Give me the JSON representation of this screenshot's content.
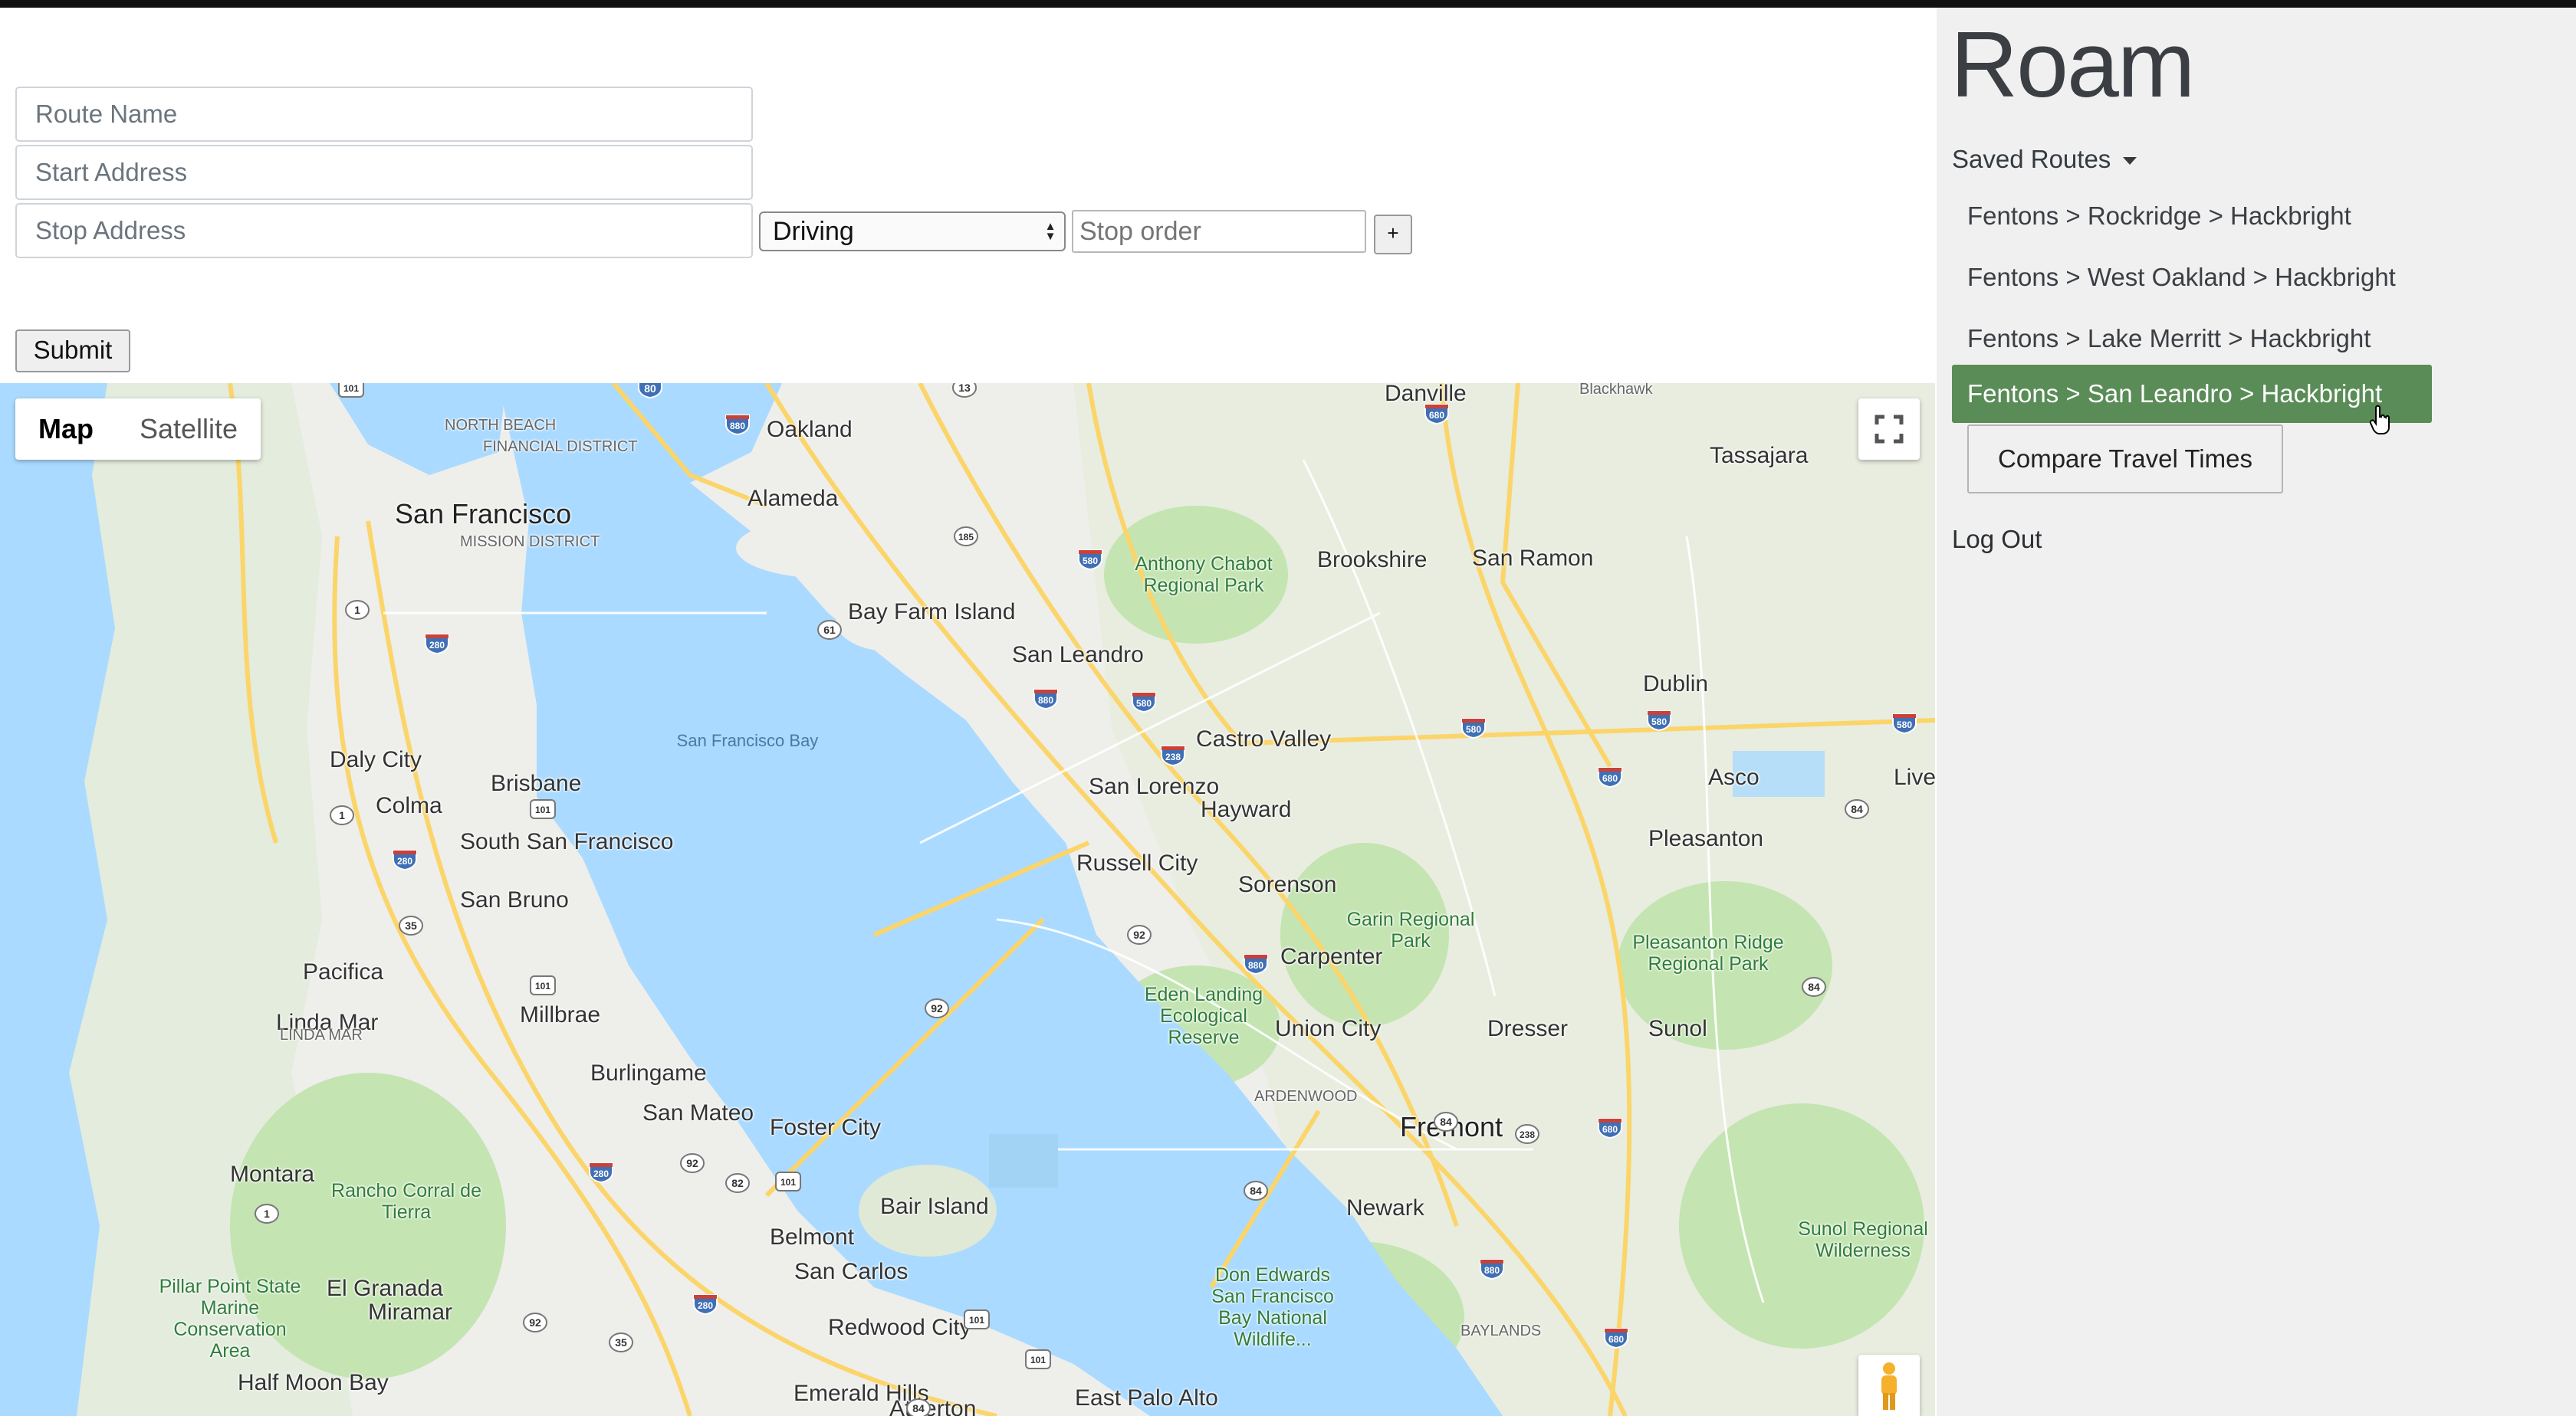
{
  "app": {
    "brand": "Roam"
  },
  "form": {
    "route_name_placeholder": "Route Name",
    "start_address_placeholder": "Start Address",
    "stop_address_placeholder": "Stop Address",
    "mode_selected": "Driving",
    "stop_order_placeholder": "Stop order",
    "add_stop_label": "+",
    "submit_label": "Submit"
  },
  "sidebar": {
    "saved_routes_label": "Saved Routes",
    "routes": [
      {
        "label": "Fentons > Rockridge > Hackbright",
        "active": false
      },
      {
        "label": "Fentons > West Oakland > Hackbright",
        "active": false
      },
      {
        "label": "Fentons > Lake Merritt > Hackbright",
        "active": false
      },
      {
        "label": "Fentons > San Leandro > Hackbright",
        "active": true
      }
    ],
    "compare_label": "Compare Travel Times",
    "logout_label": "Log Out"
  },
  "map": {
    "type_map_label": "Map",
    "type_satellite_label": "Satellite",
    "colors": {
      "water": "#aadaff",
      "land": "#eeeeeb",
      "park": "#c4e4b2",
      "highway": "#fbd56a"
    },
    "places": [
      {
        "name": "Danville",
        "kind": "city"
      },
      {
        "name": "Blackhawk",
        "kind": "small"
      },
      {
        "name": "Oakland",
        "kind": "city"
      },
      {
        "name": "NORTH BEACH",
        "kind": "small"
      },
      {
        "name": "FINANCIAL DISTRICT",
        "kind": "small"
      },
      {
        "name": "Tassajara",
        "kind": "city"
      },
      {
        "name": "Alameda",
        "kind": "city"
      },
      {
        "name": "San Francisco",
        "kind": "big"
      },
      {
        "name": "MISSION DISTRICT",
        "kind": "small"
      },
      {
        "name": "Anthony Chabot Regional Park",
        "kind": "park"
      },
      {
        "name": "Brookshire",
        "kind": "city"
      },
      {
        "name": "San Ramon",
        "kind": "city"
      },
      {
        "name": "Bay Farm Island",
        "kind": "city"
      },
      {
        "name": "San Leandro",
        "kind": "city"
      },
      {
        "name": "Dublin",
        "kind": "city"
      },
      {
        "name": "Castro Valley",
        "kind": "city"
      },
      {
        "name": "San Francisco Bay",
        "kind": "water"
      },
      {
        "name": "Daly City",
        "kind": "city"
      },
      {
        "name": "Brisbane",
        "kind": "city"
      },
      {
        "name": "Asco",
        "kind": "city"
      },
      {
        "name": "Liver",
        "kind": "city"
      },
      {
        "name": "San Lorenzo",
        "kind": "city"
      },
      {
        "name": "Colma",
        "kind": "city"
      },
      {
        "name": "Hayward",
        "kind": "city"
      },
      {
        "name": "Pleasanton",
        "kind": "city"
      },
      {
        "name": "South San Francisco",
        "kind": "city"
      },
      {
        "name": "Russell City",
        "kind": "city"
      },
      {
        "name": "Sorenson",
        "kind": "city"
      },
      {
        "name": "San Bruno",
        "kind": "city"
      },
      {
        "name": "Garin Regional Park",
        "kind": "park"
      },
      {
        "name": "Pleasanton Ridge Regional Park",
        "kind": "park"
      },
      {
        "name": "Carpenter",
        "kind": "city"
      },
      {
        "name": "Pacifica",
        "kind": "city"
      },
      {
        "name": "Eden Landing Ecological Reserve",
        "kind": "park"
      },
      {
        "name": "Millbrae",
        "kind": "city"
      },
      {
        "name": "Linda Mar",
        "kind": "city"
      },
      {
        "name": "LINDA MAR",
        "kind": "small"
      },
      {
        "name": "Union City",
        "kind": "city"
      },
      {
        "name": "Dresser",
        "kind": "city"
      },
      {
        "name": "Sunol",
        "kind": "city"
      },
      {
        "name": "Burlingame",
        "kind": "city"
      },
      {
        "name": "ARDENWOOD",
        "kind": "small"
      },
      {
        "name": "San Mateo",
        "kind": "city"
      },
      {
        "name": "Foster City",
        "kind": "city"
      },
      {
        "name": "Fremont",
        "kind": "big"
      },
      {
        "name": "Montara",
        "kind": "city"
      },
      {
        "name": "Rancho Corral de Tierra",
        "kind": "park"
      },
      {
        "name": "Bair Island",
        "kind": "city"
      },
      {
        "name": "Newark",
        "kind": "city"
      },
      {
        "name": "Belmont",
        "kind": "city"
      },
      {
        "name": "Sunol Regional Wilderness",
        "kind": "park"
      },
      {
        "name": "San Carlos",
        "kind": "city"
      },
      {
        "name": "Pillar Point State Marine Conservation Area",
        "kind": "park"
      },
      {
        "name": "El Granada",
        "kind": "city"
      },
      {
        "name": "Miramar",
        "kind": "city"
      },
      {
        "name": "Don Edwards San Francisco Bay National Wildlife...",
        "kind": "park"
      },
      {
        "name": "BAYLANDS",
        "kind": "small"
      },
      {
        "name": "Redwood City",
        "kind": "city"
      },
      {
        "name": "Half Moon Bay",
        "kind": "city"
      },
      {
        "name": "Emerald Hills",
        "kind": "city"
      },
      {
        "name": "Atherton",
        "kind": "city"
      },
      {
        "name": "East Palo Alto",
        "kind": "city"
      }
    ],
    "shields": [
      {
        "num": "101",
        "type": "us"
      },
      {
        "num": "80",
        "type": "interstate"
      },
      {
        "num": "13",
        "type": "state"
      },
      {
        "num": "680",
        "type": "interstate"
      },
      {
        "num": "880",
        "type": "interstate"
      },
      {
        "num": "185",
        "type": "state"
      },
      {
        "num": "580",
        "type": "interstate"
      },
      {
        "num": "1",
        "type": "state"
      },
      {
        "num": "280",
        "type": "interstate"
      },
      {
        "num": "61",
        "type": "state"
      },
      {
        "num": "880",
        "type": "interstate"
      },
      {
        "num": "580",
        "type": "interstate"
      },
      {
        "num": "580",
        "type": "interstate"
      },
      {
        "num": "580",
        "type": "interstate"
      },
      {
        "num": "580",
        "type": "interstate"
      },
      {
        "num": "238",
        "type": "interstate"
      },
      {
        "num": "680",
        "type": "interstate"
      },
      {
        "num": "101",
        "type": "us"
      },
      {
        "num": "1",
        "type": "state"
      },
      {
        "num": "84",
        "type": "state"
      },
      {
        "num": "280",
        "type": "interstate"
      },
      {
        "num": "35",
        "type": "state"
      },
      {
        "num": "92",
        "type": "state"
      },
      {
        "num": "880",
        "type": "interstate"
      },
      {
        "num": "101",
        "type": "us"
      },
      {
        "num": "92",
        "type": "state"
      },
      {
        "num": "84",
        "type": "state"
      },
      {
        "num": "84",
        "type": "state"
      },
      {
        "num": "238",
        "type": "state"
      },
      {
        "num": "680",
        "type": "interstate"
      },
      {
        "num": "280",
        "type": "interstate"
      },
      {
        "num": "92",
        "type": "state"
      },
      {
        "num": "82",
        "type": "state"
      },
      {
        "num": "101",
        "type": "us"
      },
      {
        "num": "84",
        "type": "state"
      },
      {
        "num": "1",
        "type": "state"
      },
      {
        "num": "880",
        "type": "interstate"
      },
      {
        "num": "280",
        "type": "interstate"
      },
      {
        "num": "92",
        "type": "state"
      },
      {
        "num": "35",
        "type": "state"
      },
      {
        "num": "101",
        "type": "us"
      },
      {
        "num": "101",
        "type": "us"
      },
      {
        "num": "84",
        "type": "state"
      },
      {
        "num": "680",
        "type": "interstate"
      }
    ]
  }
}
